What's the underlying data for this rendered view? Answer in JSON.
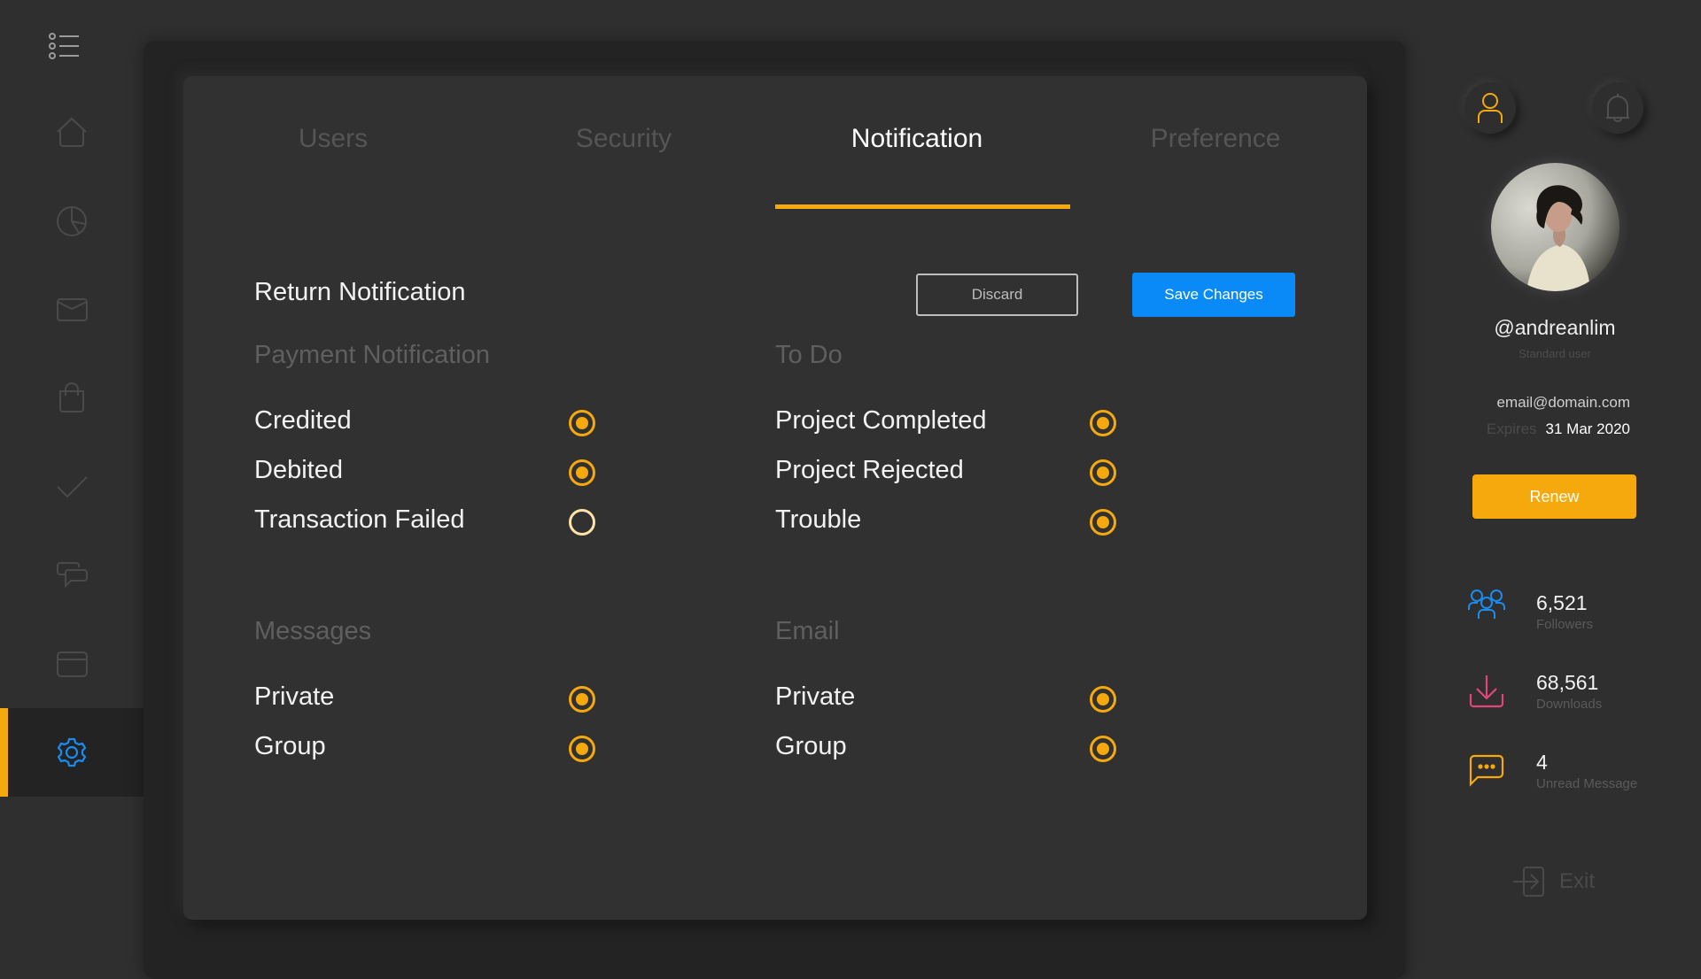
{
  "sidebar": {
    "menu_icon": "list-menu-icon",
    "items": [
      {
        "name": "home",
        "icon": "home-icon",
        "active": false
      },
      {
        "name": "analytics",
        "icon": "pie-chart-icon",
        "active": false
      },
      {
        "name": "mail",
        "icon": "mail-icon",
        "active": false
      },
      {
        "name": "shop",
        "icon": "shopping-bag-icon",
        "active": false
      },
      {
        "name": "tasks",
        "icon": "check-icon",
        "active": false
      },
      {
        "name": "chat",
        "icon": "chat-bubbles-icon",
        "active": false
      },
      {
        "name": "payments",
        "icon": "credit-card-icon",
        "active": false
      },
      {
        "name": "settings",
        "icon": "gear-icon",
        "active": true
      }
    ]
  },
  "colors": {
    "accent": "#f5a90c",
    "primary": "#0a8af7",
    "background": "#2f2f2f",
    "panel": "#232323",
    "card": "#313131"
  },
  "tabs": [
    {
      "label": "Users",
      "active": false
    },
    {
      "label": "Security",
      "active": false
    },
    {
      "label": "Notification",
      "active": true
    },
    {
      "label": "Preference",
      "active": false
    }
  ],
  "main": {
    "title": "Return Notification",
    "discard_label": "Discard",
    "save_label": "Save Changes",
    "sections": [
      {
        "title": "Payment Notification",
        "options": [
          {
            "label": "Credited",
            "checked": true
          },
          {
            "label": "Debited",
            "checked": true
          },
          {
            "label": "Transaction Failed",
            "checked": false
          }
        ]
      },
      {
        "title": "To Do",
        "options": [
          {
            "label": "Project Completed",
            "checked": true
          },
          {
            "label": "Project Rejected",
            "checked": true
          },
          {
            "label": "Trouble",
            "checked": true
          }
        ]
      },
      {
        "title": "Messages",
        "options": [
          {
            "label": "Private",
            "checked": true
          },
          {
            "label": "Group",
            "checked": true
          }
        ]
      },
      {
        "title": "Email",
        "options": [
          {
            "label": "Private",
            "checked": true
          },
          {
            "label": "Group",
            "checked": true
          }
        ]
      }
    ]
  },
  "profile": {
    "username": "@andreanlim",
    "user_type": "Standard user",
    "email": "email@domain.com",
    "expires_label": "Expires",
    "expires_date": "31 Mar 2020",
    "renew_label": "Renew",
    "stats": [
      {
        "value": "6,521",
        "label": "Followers",
        "icon": "users-group-icon",
        "color": "#1a8cf0"
      },
      {
        "value": "68,561",
        "label": "Downloads",
        "icon": "download-icon",
        "color": "#e2457a"
      },
      {
        "value": "4",
        "label": "Unread Message",
        "icon": "message-dots-icon",
        "color": "#f5a90c"
      }
    ],
    "exit_label": "Exit"
  }
}
